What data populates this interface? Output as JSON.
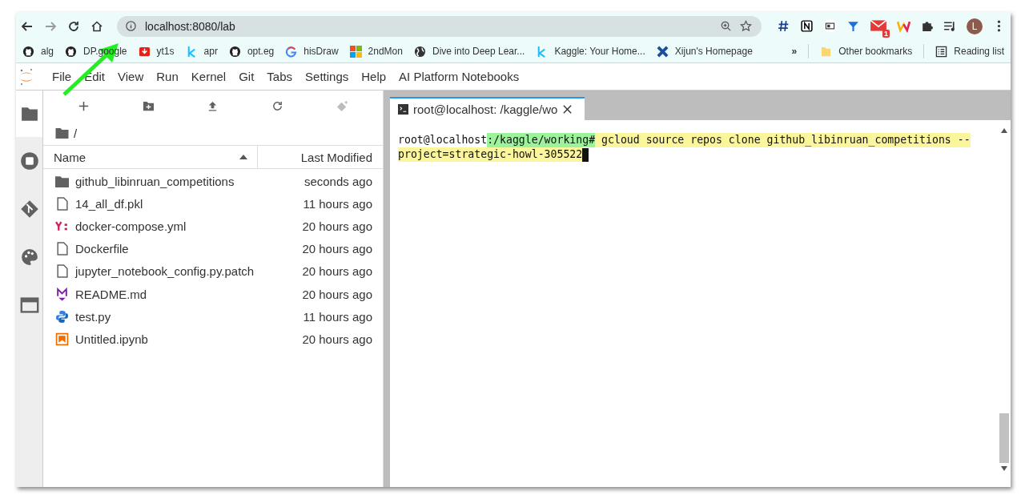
{
  "browser": {
    "address": "localhost:8080/lab",
    "profile_initial": "L",
    "mail_badge": "1",
    "bookmarks": [
      {
        "kind": "github",
        "label": "alg"
      },
      {
        "kind": "github",
        "label": "DP.google"
      },
      {
        "kind": "youtube",
        "label": "yt1s"
      },
      {
        "kind": "kaggle",
        "label": "apr"
      },
      {
        "kind": "github",
        "label": "opt.eg"
      },
      {
        "kind": "google",
        "label": "hisDraw"
      },
      {
        "kind": "windows",
        "label": "2ndMon"
      },
      {
        "kind": "globe",
        "label": "Dive into Deep Lear..."
      },
      {
        "kind": "kaggle",
        "label": "Kaggle: Your Home..."
      },
      {
        "kind": "cross",
        "label": "Xijun's Homepage"
      }
    ],
    "overflow": "»",
    "other_bookmarks": "Other bookmarks",
    "reading_list": "Reading list"
  },
  "menu": [
    "File",
    "Edit",
    "View",
    "Run",
    "Kernel",
    "Git",
    "Tabs",
    "Settings",
    "Help",
    "AI Platform Notebooks"
  ],
  "sidebar": {
    "tabs": [
      {
        "kind": "files",
        "selected": true
      },
      {
        "kind": "running",
        "selected": false
      },
      {
        "kind": "git",
        "selected": false
      },
      {
        "kind": "palette",
        "selected": false
      },
      {
        "kind": "tabs",
        "selected": false
      }
    ]
  },
  "file_browser": {
    "path": "/",
    "columns": [
      "Name",
      "Last Modified"
    ],
    "rows": [
      {
        "kind": "folder",
        "name": "github_libinruan_competitions",
        "modified": "seconds ago"
      },
      {
        "kind": "file",
        "name": "14_all_df.pkl",
        "modified": "11 hours ago"
      },
      {
        "kind": "yaml",
        "name": "docker-compose.yml",
        "modified": "20 hours ago"
      },
      {
        "kind": "file",
        "name": "Dockerfile",
        "modified": "20 hours ago"
      },
      {
        "kind": "file",
        "name": "jupyter_notebook_config.py.patch",
        "modified": "20 hours ago"
      },
      {
        "kind": "markdown",
        "name": "README.md",
        "modified": "20 hours ago"
      },
      {
        "kind": "python",
        "name": "test.py",
        "modified": "11 hours ago"
      },
      {
        "kind": "notebook",
        "name": "Untitled.ipynb",
        "modified": "20 hours ago"
      }
    ]
  },
  "terminal": {
    "tab_title": "root@localhost: /kaggle/wo",
    "host": "root@localhost",
    "path": ":/kaggle/working#",
    "command_line_1": " gcloud source repos clone github_libinruan_competitions --",
    "command_line_2": "project=strategic-howl-305522"
  }
}
